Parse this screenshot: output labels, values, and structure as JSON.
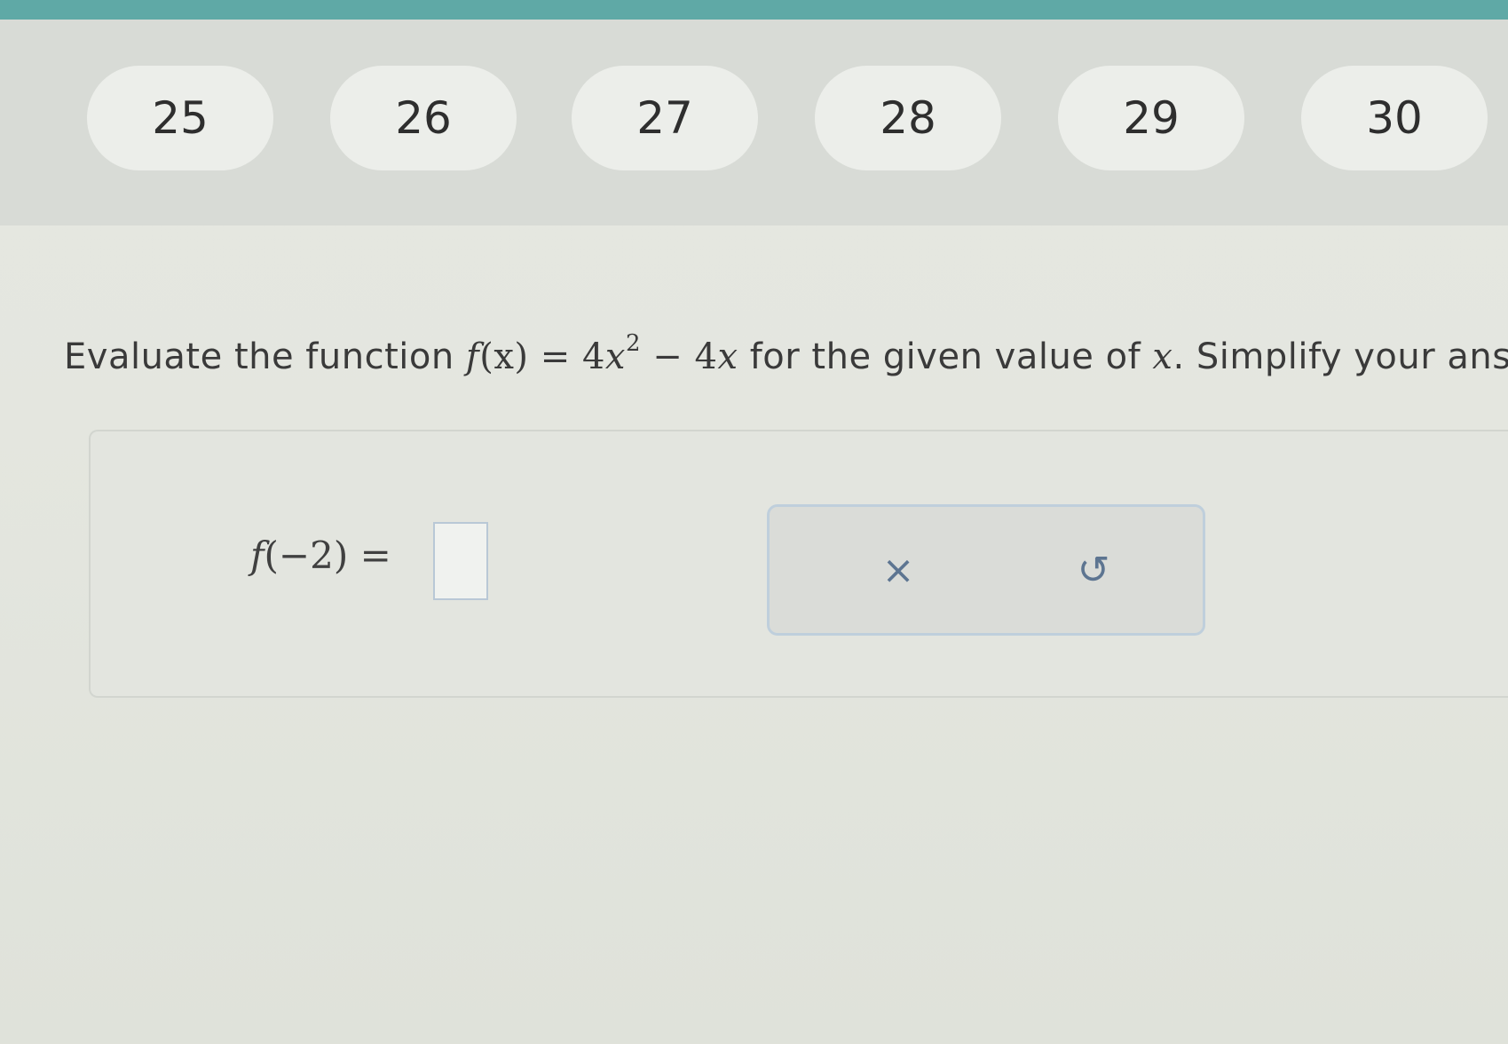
{
  "nav": {
    "items": [
      {
        "label": "25"
      },
      {
        "label": "26"
      },
      {
        "label": "27"
      },
      {
        "label": "28"
      },
      {
        "label": "29"
      },
      {
        "label": "30"
      }
    ]
  },
  "question": {
    "text_before": "Evaluate the function ",
    "func_name": "f",
    "func_var": "(x)",
    "equals": " = ",
    "term1_coef": "4",
    "term1_var": "x",
    "exponent": "2",
    "minus": " − ",
    "term2_coef": "4",
    "term2_var": "x",
    "text_mid": " for the given value of ",
    "var_x": "x",
    "text_after": ". Simplify your answe"
  },
  "answer": {
    "func": "f",
    "arg": "(−2)",
    "equals": " = ",
    "value": ""
  },
  "tools": {
    "clear_icon": "×",
    "undo_icon": "↺"
  },
  "colors": {
    "top_strip": "#5fa9a6",
    "icon_color": "#5d7591"
  }
}
